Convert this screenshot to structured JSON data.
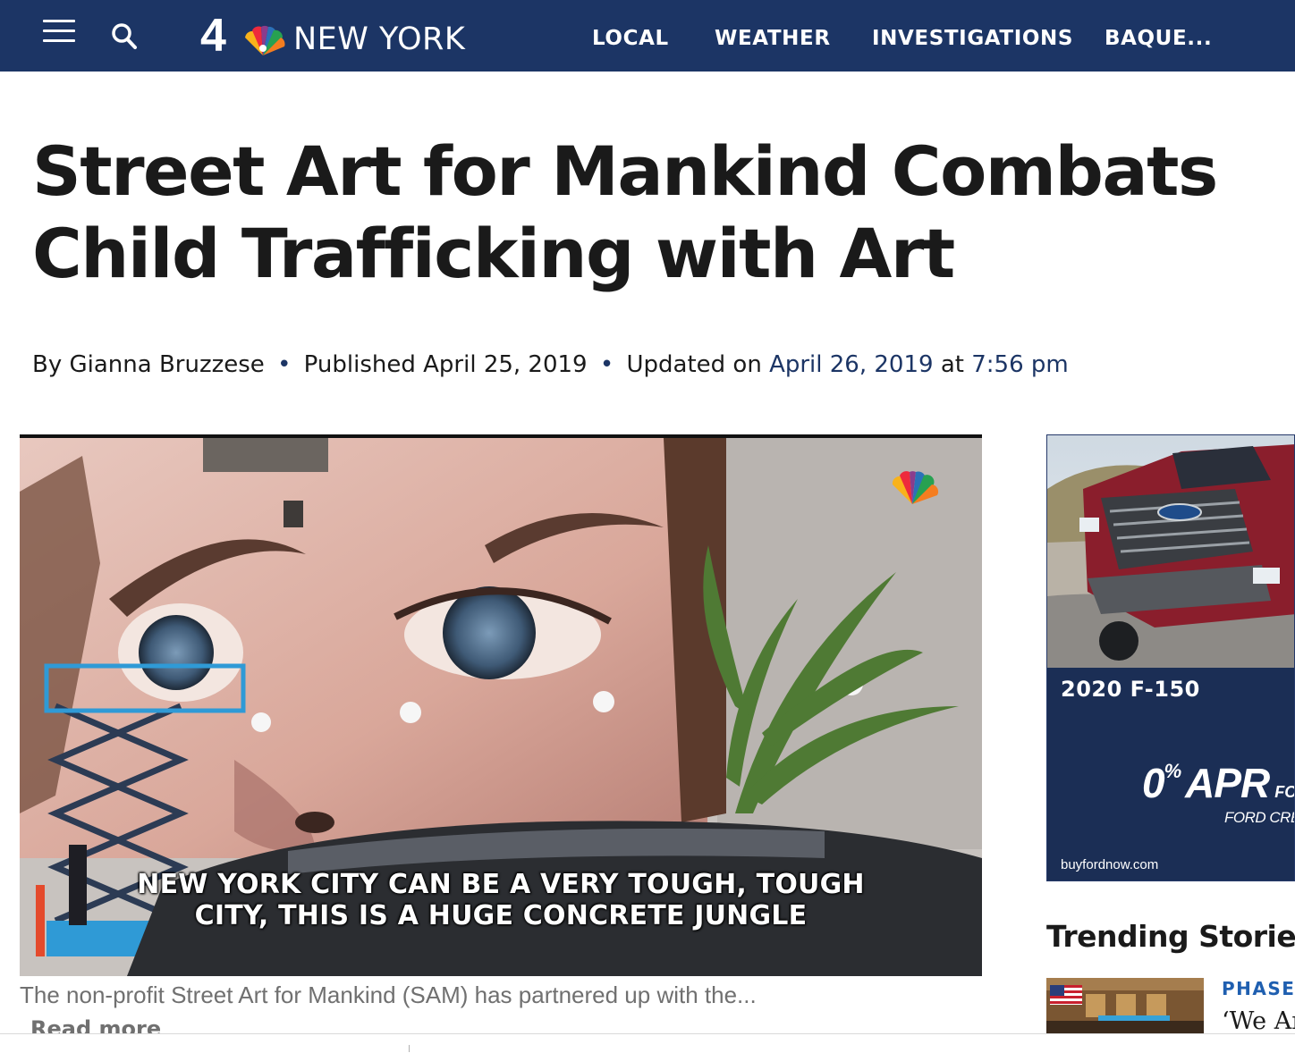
{
  "header": {
    "logo_number": "4",
    "logo_text": "NEW YORK",
    "nav": [
      "LOCAL",
      "WEATHER",
      "INVESTIGATIONS",
      "BAQUE..."
    ],
    "icons": {
      "menu": "hamburger-menu-icon",
      "search": "search-icon",
      "logo": "nbc-peacock-icon"
    },
    "colors": {
      "bar": "#1c3565",
      "text": "#ffffff"
    }
  },
  "article": {
    "headline": "Street Art for Mankind Combats Child Trafficking with Art",
    "byline": {
      "prefix": "By",
      "author": "Gianna Bruzzese",
      "separator": "•",
      "published_label": "Published",
      "published_date": "April 25, 2019",
      "updated_label": "Updated on",
      "updated_date": "April 26, 2019",
      "at_label": "at",
      "updated_time": "7:56 pm"
    },
    "video": {
      "caption_overlay_line1": "NEW YORK CITY CAN BE A VERY TOUGH, TOUGH",
      "caption_overlay_line2": "CITY, THIS IS A HUGE CONCRETE JUNGLE",
      "watermark_icon": "nbc-peacock-icon"
    },
    "summary": "The non-profit Street Art for Mankind (SAM) has partnered up with the...",
    "read_more": "Read more"
  },
  "ad": {
    "model": "2020 F-150",
    "apr_value": "0",
    "apr_percent": "%",
    "apr_label": "APR",
    "apr_for": "FOR",
    "credit_text": "FORD CRE",
    "url": "buyfordnow.com",
    "colors": {
      "background": "#1b2e55",
      "truck": "#8a1e2c"
    }
  },
  "trending": {
    "title": "Trending Stories",
    "items": [
      {
        "kicker": "PHASE",
        "headline": "‘We Ar"
      }
    ]
  },
  "accent_colors": {
    "link": "#1c3565",
    "kicker": "#1f5fb0",
    "muted_text": "#707070"
  }
}
